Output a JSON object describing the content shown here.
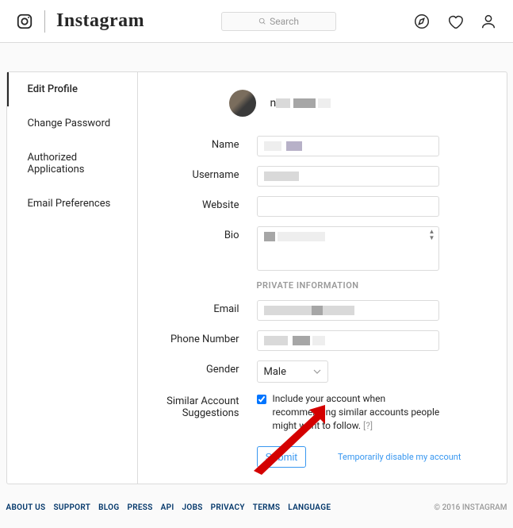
{
  "header": {
    "wordmark": "Instagram",
    "search_placeholder": "Search"
  },
  "sidebar": {
    "items": [
      {
        "label": "Edit Profile",
        "active": true
      },
      {
        "label": "Change Password",
        "active": false
      },
      {
        "label": "Authorized Applications",
        "active": false
      },
      {
        "label": "Email Preferences",
        "active": false
      }
    ]
  },
  "profile": {
    "display_name_prefix": "n"
  },
  "form": {
    "name_label": "Name",
    "username_label": "Username",
    "website_label": "Website",
    "bio_label": "Bio",
    "private_section": "PRIVATE INFORMATION",
    "email_label": "Email",
    "phone_label": "Phone Number",
    "gender_label": "Gender",
    "gender_value": "Male",
    "similar_label_line1": "Similar Account",
    "similar_label_line2": "Suggestions",
    "similar_text": "Include your account when recommending similar accounts people might want to follow.",
    "similar_help": "[?]",
    "submit_label": "Submit",
    "disable_link": "Temporarily disable my account"
  },
  "footer": {
    "links": [
      "ABOUT US",
      "SUPPORT",
      "BLOG",
      "PRESS",
      "API",
      "JOBS",
      "PRIVACY",
      "TERMS",
      "LANGUAGE"
    ],
    "copyright": "© 2016 INSTAGRAM"
  }
}
